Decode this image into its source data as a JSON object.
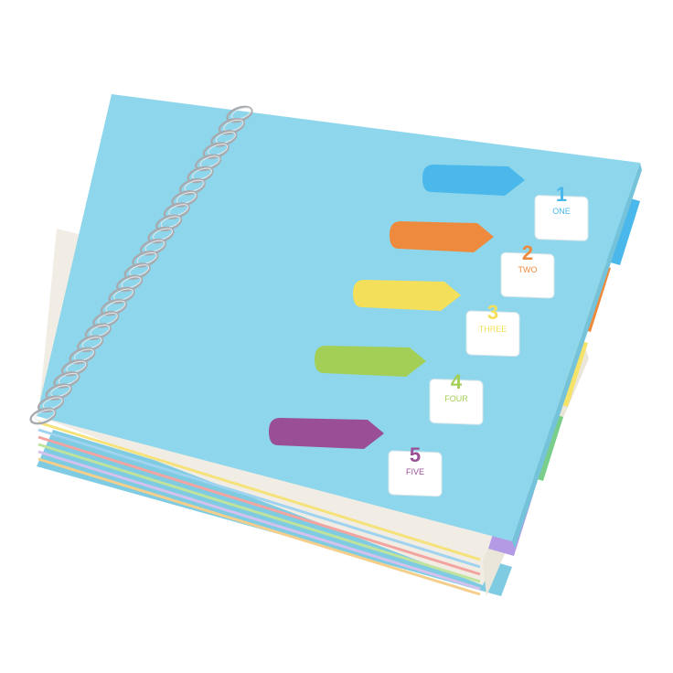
{
  "colors": {
    "background": "#ffffff",
    "cover": "#8dd6ea",
    "cover_shadow": "#6fbfd6",
    "coil": "#b9bcc0"
  },
  "sections": [
    {
      "number": "1",
      "word": "ONE",
      "color": "#4ab8ea",
      "tab_color": "#4ab8ea"
    },
    {
      "number": "2",
      "word": "TWO",
      "color": "#ee8a3d",
      "tab_color": "#ef8a3a"
    },
    {
      "number": "3",
      "word": "THREE",
      "color": "#f4df5a",
      "tab_color": "#f6e36a"
    },
    {
      "number": "4",
      "word": "FOUR",
      "color": "#a3cf57",
      "tab_color": "#79cf8a"
    },
    {
      "number": "5",
      "word": "FIVE",
      "color": "#9a4e96",
      "tab_color": "#b49ae4"
    }
  ]
}
